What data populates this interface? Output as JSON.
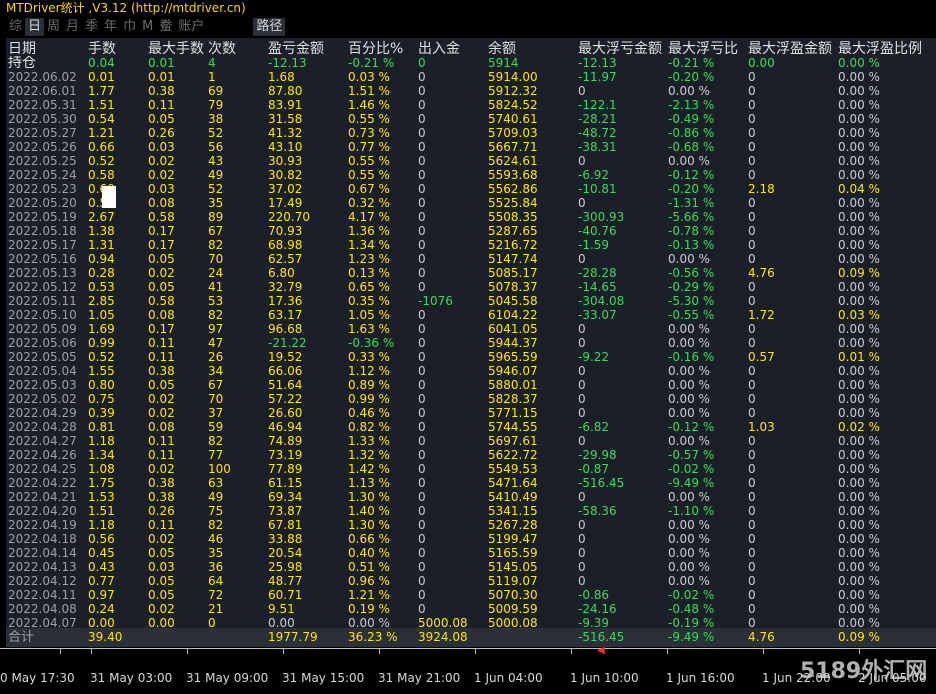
{
  "window": {
    "title": "MTDriver统计 ,V3.12 (http://mtdriver.cn)"
  },
  "tabs": [
    {
      "label": "综",
      "active": false
    },
    {
      "label": "日",
      "active": true
    },
    {
      "label": "周",
      "active": false
    },
    {
      "label": "月",
      "active": false
    },
    {
      "label": "季",
      "active": false
    },
    {
      "label": "年",
      "active": false
    },
    {
      "label": "巾",
      "active": false
    },
    {
      "label": "M",
      "active": false
    },
    {
      "label": "鲞",
      "active": false
    },
    {
      "label": "账户",
      "active": false
    },
    {
      "label": "路径",
      "active": true
    }
  ],
  "table": {
    "headers": [
      "日期",
      "手数",
      "最大手数",
      "次数",
      "盈亏金额",
      "百分比%",
      "出入金",
      "余额",
      "最大浮亏金额",
      "最大浮亏比",
      "最大浮盈金额",
      "最大浮盈比例"
    ],
    "holding": {
      "label": "持仓",
      "cells": [
        "0.04",
        "0.01",
        "4",
        "-12.13",
        "-0.21 %",
        "0",
        "5914",
        "-12.13",
        "-0.21 %",
        "0.00",
        "0.00 %"
      ]
    },
    "rows": [
      [
        "2022.06.02",
        "0.01",
        "0.01",
        "1",
        "1.68",
        "0.03 %",
        "0",
        "5914.00",
        "-11.97",
        "-0.20 %",
        "0",
        "0.00 %"
      ],
      [
        "2022.06.01",
        "1.77",
        "0.38",
        "69",
        "87.80",
        "1.51 %",
        "0",
        "5912.32",
        "0",
        "0.00 %",
        "0",
        "0.00 %"
      ],
      [
        "2022.05.31",
        "1.51",
        "0.11",
        "79",
        "83.91",
        "1.46 %",
        "0",
        "5824.52",
        "-122.1",
        "-2.13 %",
        "0",
        "0.00 %"
      ],
      [
        "2022.05.30",
        "0.54",
        "0.05",
        "38",
        "31.58",
        "0.55 %",
        "0",
        "5740.61",
        "-28.21",
        "-0.49 %",
        "0",
        "0.00 %"
      ],
      [
        "2022.05.27",
        "1.21",
        "0.26",
        "52",
        "41.32",
        "0.73 %",
        "0",
        "5709.03",
        "-48.72",
        "-0.86 %",
        "0",
        "0.00 %"
      ],
      [
        "2022.05.26",
        "0.66",
        "0.03",
        "56",
        "43.10",
        "0.77 %",
        "0",
        "5667.71",
        "-38.31",
        "-0.68 %",
        "0",
        "0.00 %"
      ],
      [
        "2022.05.25",
        "0.52",
        "0.02",
        "43",
        "30.93",
        "0.55 %",
        "0",
        "5624.61",
        "0",
        "0.00 %",
        "0",
        "0.00 %"
      ],
      [
        "2022.05.24",
        "0.58",
        "0.02",
        "49",
        "30.82",
        "0.55 %",
        "0",
        "5593.68",
        "-6.92",
        "-0.12 %",
        "0",
        "0.00 %"
      ],
      [
        "2022.05.23",
        "0.60",
        "0.03",
        "52",
        "37.02",
        "0.67 %",
        "0",
        "5562.86",
        "-10.81",
        "-0.20 %",
        "2.18",
        "0.04 %"
      ],
      [
        "2022.05.20",
        "0.51",
        "0.08",
        "35",
        "17.49",
        "0.32 %",
        "0",
        "5525.84",
        "0",
        "-1.31 %",
        "0",
        "0.00 %"
      ],
      [
        "2022.05.19",
        "2.67",
        "0.58",
        "89",
        "220.70",
        "4.17 %",
        "0",
        "5508.35",
        "-300.93",
        "-5.66 %",
        "0",
        "0.00 %"
      ],
      [
        "2022.05.18",
        "1.38",
        "0.17",
        "67",
        "70.93",
        "1.36 %",
        "0",
        "5287.65",
        "-40.76",
        "-0.78 %",
        "0",
        "0.00 %"
      ],
      [
        "2022.05.17",
        "1.31",
        "0.17",
        "82",
        "68.98",
        "1.34 %",
        "0",
        "5216.72",
        "-1.59",
        "-0.13 %",
        "0",
        "0.00 %"
      ],
      [
        "2022.05.16",
        "0.94",
        "0.05",
        "70",
        "62.57",
        "1.23 %",
        "0",
        "5147.74",
        "0",
        "0.00 %",
        "0",
        "0.00 %"
      ],
      [
        "2022.05.13",
        "0.28",
        "0.02",
        "24",
        "6.80",
        "0.13 %",
        "0",
        "5085.17",
        "-28.28",
        "-0.56 %",
        "4.76",
        "0.09 %"
      ],
      [
        "2022.05.12",
        "0.53",
        "0.05",
        "41",
        "32.79",
        "0.65 %",
        "0",
        "5078.37",
        "-14.65",
        "-0.29 %",
        "0",
        "0.00 %"
      ],
      [
        "2022.05.11",
        "2.85",
        "0.58",
        "53",
        "17.36",
        "0.35 %",
        "-1076",
        "5045.58",
        "-304.08",
        "-5.30 %",
        "0",
        "0.00 %"
      ],
      [
        "2022.05.10",
        "1.05",
        "0.08",
        "82",
        "63.17",
        "1.05 %",
        "0",
        "6104.22",
        "-33.07",
        "-0.55 %",
        "1.72",
        "0.03 %"
      ],
      [
        "2022.05.09",
        "1.69",
        "0.17",
        "97",
        "96.68",
        "1.63 %",
        "0",
        "6041.05",
        "0",
        "0.00 %",
        "0",
        "0.00 %"
      ],
      [
        "2022.05.06",
        "0.99",
        "0.11",
        "47",
        "-21.22",
        "-0.36 %",
        "0",
        "5944.37",
        "0",
        "0.00 %",
        "0",
        "0.00 %"
      ],
      [
        "2022.05.05",
        "0.52",
        "0.11",
        "26",
        "19.52",
        "0.33 %",
        "0",
        "5965.59",
        "-9.22",
        "-0.16 %",
        "0.57",
        "0.01 %"
      ],
      [
        "2022.05.04",
        "1.55",
        "0.38",
        "34",
        "66.06",
        "1.12 %",
        "0",
        "5946.07",
        "0",
        "0.00 %",
        "0",
        "0.00 %"
      ],
      [
        "2022.05.03",
        "0.80",
        "0.05",
        "67",
        "51.64",
        "0.89 %",
        "0",
        "5880.01",
        "0",
        "0.00 %",
        "0",
        "0.00 %"
      ],
      [
        "2022.05.02",
        "0.75",
        "0.02",
        "70",
        "57.22",
        "0.99 %",
        "0",
        "5828.37",
        "0",
        "0.00 %",
        "0",
        "0.00 %"
      ],
      [
        "2022.04.29",
        "0.39",
        "0.02",
        "37",
        "26.60",
        "0.46 %",
        "0",
        "5771.15",
        "0",
        "0.00 %",
        "0",
        "0.00 %"
      ],
      [
        "2022.04.28",
        "0.81",
        "0.08",
        "59",
        "46.94",
        "0.82 %",
        "0",
        "5744.55",
        "-6.82",
        "-0.12 %",
        "1.03",
        "0.02 %"
      ],
      [
        "2022.04.27",
        "1.18",
        "0.11",
        "82",
        "74.89",
        "1.33 %",
        "0",
        "5697.61",
        "0",
        "0.00 %",
        "0",
        "0.00 %"
      ],
      [
        "2022.04.26",
        "1.34",
        "0.11",
        "77",
        "73.19",
        "1.32 %",
        "0",
        "5622.72",
        "-29.98",
        "-0.57 %",
        "0",
        "0.00 %"
      ],
      [
        "2022.04.25",
        "1.08",
        "0.02",
        "100",
        "77.89",
        "1.42 %",
        "0",
        "5549.53",
        "-0.87",
        "-0.02 %",
        "0",
        "0.00 %"
      ],
      [
        "2022.04.22",
        "1.75",
        "0.38",
        "63",
        "61.15",
        "1.13 %",
        "0",
        "5471.64",
        "-516.45",
        "-9.49 %",
        "0",
        "0.00 %"
      ],
      [
        "2022.04.21",
        "1.53",
        "0.38",
        "49",
        "69.34",
        "1.30 %",
        "0",
        "5410.49",
        "0",
        "0.00 %",
        "0",
        "0.00 %"
      ],
      [
        "2022.04.20",
        "1.51",
        "0.26",
        "75",
        "73.87",
        "1.40 %",
        "0",
        "5341.15",
        "-58.36",
        "-1.10 %",
        "0",
        "0.00 %"
      ],
      [
        "2022.04.19",
        "1.18",
        "0.11",
        "82",
        "67.81",
        "1.30 %",
        "0",
        "5267.28",
        "0",
        "0.00 %",
        "0",
        "0.00 %"
      ],
      [
        "2022.04.18",
        "0.56",
        "0.02",
        "46",
        "33.88",
        "0.66 %",
        "0",
        "5199.47",
        "0",
        "0.00 %",
        "0",
        "0.00 %"
      ],
      [
        "2022.04.14",
        "0.45",
        "0.05",
        "35",
        "20.54",
        "0.40 %",
        "0",
        "5165.59",
        "0",
        "0.00 %",
        "0",
        "0.00 %"
      ],
      [
        "2022.04.13",
        "0.43",
        "0.03",
        "36",
        "25.98",
        "0.51 %",
        "0",
        "5145.05",
        "0",
        "0.00 %",
        "0",
        "0.00 %"
      ],
      [
        "2022.04.12",
        "0.77",
        "0.05",
        "64",
        "48.77",
        "0.96 %",
        "0",
        "5119.07",
        "0",
        "0.00 %",
        "0",
        "0.00 %"
      ],
      [
        "2022.04.11",
        "0.97",
        "0.05",
        "72",
        "60.71",
        "1.21 %",
        "0",
        "5070.30",
        "-0.86",
        "-0.02 %",
        "0",
        "0.00 %"
      ],
      [
        "2022.04.08",
        "0.24",
        "0.02",
        "21",
        "9.51",
        "0.19 %",
        "0",
        "5009.59",
        "-24.16",
        "-0.48 %",
        "0",
        "0.00 %"
      ],
      [
        "2022.04.07",
        "0.00",
        "0.00",
        "0",
        "0.00",
        "0.00 %",
        "5000.08",
        "5000.08",
        "-9.39",
        "-0.19 %",
        "0",
        "0.00 %"
      ]
    ],
    "total": {
      "label": "合计",
      "cells": [
        "39.40",
        "",
        "",
        "1977.79",
        "36.23 %",
        "3924.08",
        "",
        "-516.45",
        "-9.49 %",
        "4.76",
        "0.09 %"
      ]
    }
  },
  "time_axis": {
    "labels": [
      "0 May 17:30",
      "31 May 03:00",
      "31 May 09:00",
      "31 May 15:00",
      "31 May 21:00",
      "1 Jun 04:00",
      "1 Jun 10:00",
      "1 Jun 16:00",
      "1 Jun 22:00",
      "2 Jun 05:00"
    ]
  },
  "watermark": {
    "text": "5189外汇网"
  },
  "colors": {
    "positive": "#ffe600",
    "negative": "#33dd55",
    "neutral": "#c6ccd6",
    "panel_bg": "#1b1f27",
    "title": "#ffd200"
  }
}
